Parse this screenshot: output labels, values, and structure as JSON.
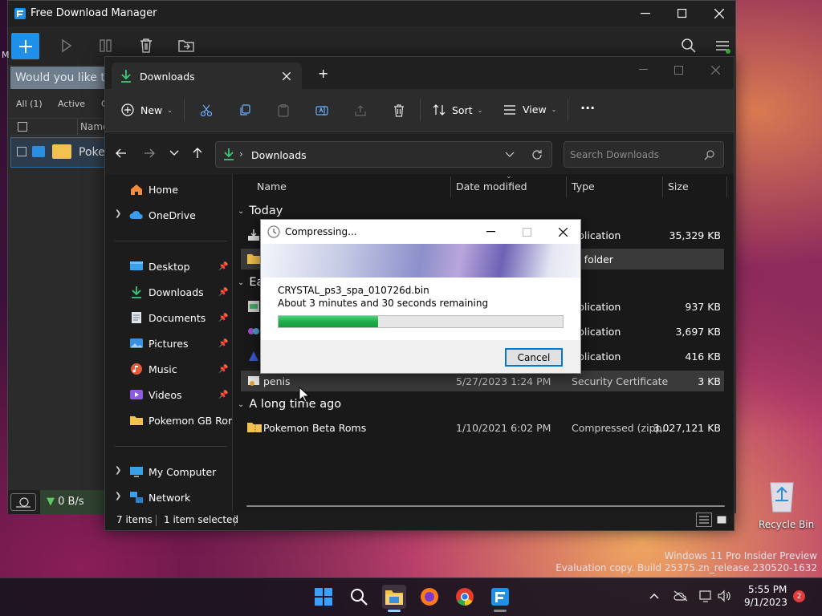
{
  "fdm": {
    "title": "Free Download Manager",
    "banner_text": "Would you like to m",
    "filters": {
      "all": "All (1)",
      "active": "Active",
      "more": "C"
    },
    "list_header": "Name",
    "row_name": "Poke",
    "speed": "0 B/s",
    "left_edge_char": "M"
  },
  "explorer": {
    "tab_title": "Downloads",
    "new_tab": "+",
    "cmd": {
      "new": "New",
      "sort": "Sort",
      "view": "View",
      "more": "···"
    },
    "address": {
      "path": "Downloads",
      "separator": "›"
    },
    "search_placeholder": "Search Downloads",
    "nav": {
      "home": "Home",
      "onedrive": "OneDrive",
      "desktop": "Desktop",
      "downloads": "Downloads",
      "documents": "Documents",
      "pictures": "Pictures",
      "music": "Music",
      "videos": "Videos",
      "pokemon": "Pokemon GB Rom",
      "my_computer": "My Computer",
      "network": "Network"
    },
    "columns": {
      "name": "Name",
      "date": "Date modified",
      "type": "Type",
      "size": "Size"
    },
    "groups": {
      "today": "Today",
      "earlier": "Ea",
      "long_ago": "A long time ago"
    },
    "rows": [
      {
        "type": "plication",
        "size": "35,329 KB"
      },
      {
        "type": "e folder",
        "size": ""
      },
      {
        "type": "plication",
        "size": "937 KB"
      },
      {
        "type": "plication",
        "size": "3,697 KB"
      },
      {
        "type": "plication",
        "size": "416 KB"
      },
      {
        "name": "penis",
        "date": "5/27/2023 1:24 PM",
        "type": "Security Certificate",
        "size": "3 KB"
      },
      {
        "name": "Pokemon Beta Roms",
        "date": "1/10/2021 6:02 PM",
        "type": "Compressed (zipp...",
        "size": "3,027,121 KB"
      }
    ],
    "status": {
      "items": "7 items",
      "selected": "1 item selected"
    }
  },
  "dialog": {
    "title": "Compressing...",
    "filename": "CRYSTAL_ps3_spa_010726d.bin",
    "remaining": "About 3 minutes and 30 seconds remaining",
    "progress": 0.35,
    "cancel": "Cancel"
  },
  "desktop": {
    "recycle_bin": "Recycle Bin",
    "watermark_line1": "Windows 11 Pro Insider Preview",
    "watermark_line2": "Evaluation copy. Build 25375.zn_release.230520-1632"
  },
  "taskbar": {
    "time": "5:55 PM",
    "date": "9/1/2023",
    "notifications": "2"
  },
  "colors": {
    "accent": "#1e90e8",
    "progress": "#1fae4a",
    "explorer_bg": "#1c1c1c"
  }
}
